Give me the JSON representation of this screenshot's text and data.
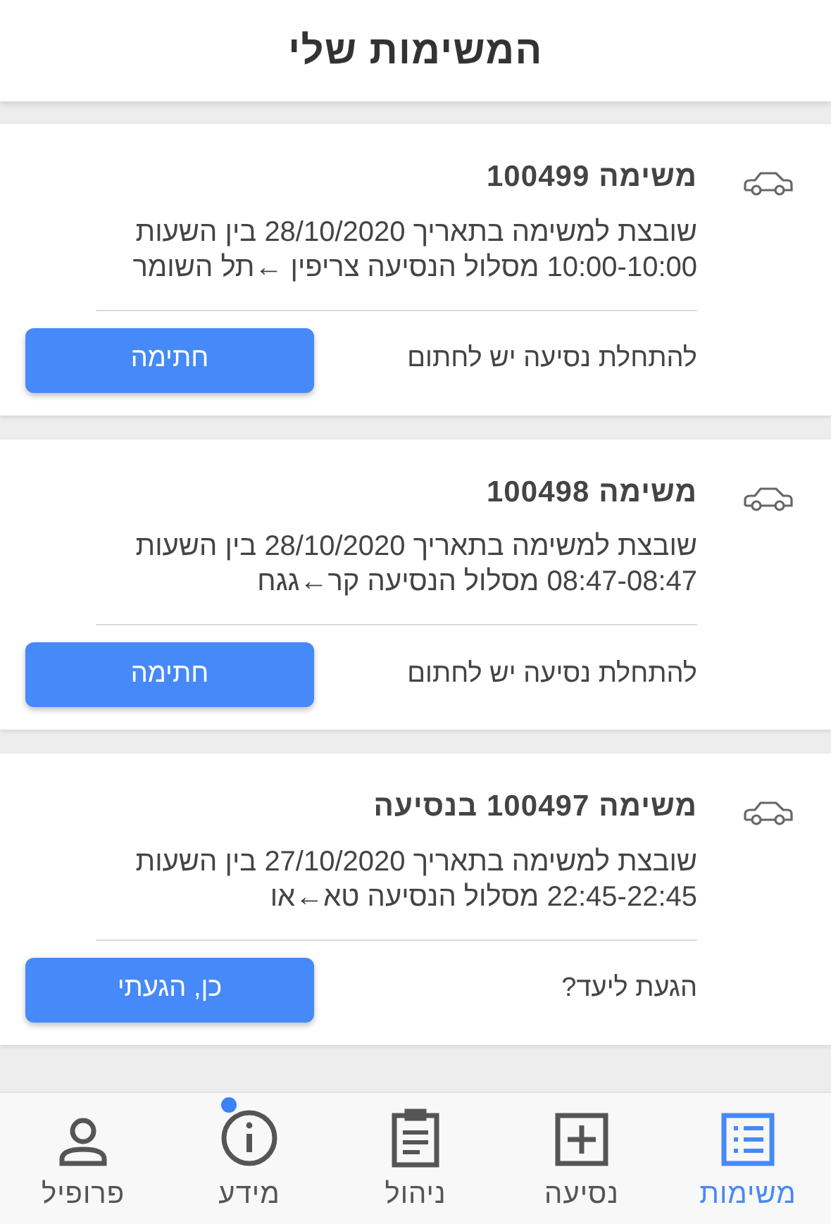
{
  "header": {
    "title": "המשימות שלי"
  },
  "tasks": [
    {
      "title": "משימה 100499",
      "description": "שובצת למשימה בתאריך 28/10/2020 בין השעות 10:00-10:00 מסלול הנסיעה צריפין ←תל השומר",
      "prompt": "להתחלת נסיעה יש לחתום",
      "button": "חתימה"
    },
    {
      "title": "משימה 100498",
      "description": "שובצת למשימה בתאריך 28/10/2020 בין השעות 08:47-08:47 מסלול הנסיעה קר←גגח",
      "prompt": "להתחלת נסיעה יש לחתום",
      "button": "חתימה"
    },
    {
      "title": "משימה 100497 בנסיעה",
      "description": "שובצת למשימה בתאריך 27/10/2020 בין השעות 22:45-22:45 מסלול הנסיעה טא←או",
      "prompt": "הגעת ליעד?",
      "button": "כן, הגעתי"
    }
  ],
  "bottom_nav": [
    {
      "kind": "list",
      "label": "משימות",
      "selected": true,
      "dot": false
    },
    {
      "kind": "plus",
      "label": "נסיעה",
      "selected": false,
      "dot": false
    },
    {
      "kind": "clipboard",
      "label": "ניהול",
      "selected": false,
      "dot": false
    },
    {
      "kind": "info",
      "label": "מידע",
      "selected": false,
      "dot": true
    },
    {
      "kind": "person",
      "label": "פרופיל",
      "selected": false,
      "dot": false
    }
  ]
}
